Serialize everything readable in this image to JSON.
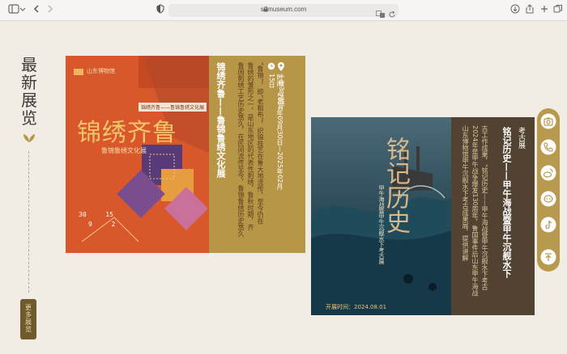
{
  "browser": {
    "url": "sdmuseum.com"
  },
  "section": {
    "title_chars": [
      "最",
      "新",
      "展",
      "览"
    ],
    "more_chars": [
      "更",
      "多",
      "展",
      "览"
    ]
  },
  "exhibitions": [
    {
      "poster": {
        "brand": "山东博物馆",
        "tag": "锦绣齐鲁——鲁锦鲁绣文化展",
        "title": "锦绣齐鲁",
        "subtitle": "鲁锦鲁绣文化展",
        "date_big": [
          "30",
          "9",
          "15",
          "2"
        ]
      },
      "panel": {
        "title": "锦绣齐鲁——鲁锦鲁绣文化展",
        "time": "时间：2024年09月30日—2025年02月15日",
        "place": "一楼3号展厅",
        "desc1": "“鲁锦”，即“老粗布”，织锦技艺在鲁大地流传，至今仍在",
        "desc2": "鲁绣的雏形之一，是山东地区的代表性刺绣，鲁秋时期，齐",
        "desc3": "鲁国刺绣工艺历史悠久，在民间流传至今，鲁锦鲁绣历史悠久"
      }
    },
    {
      "poster": {
        "title": "铭记历史",
        "subtitle": "甲午海战暨甲午沉舰水下考古展",
        "open": "开展时间：2024.08.01"
      },
      "panel": {
        "type": "考古展",
        "title": "铭记历史——甲午海战暨甲午沉舰水下",
        "desc1": "古工作成果，“铭记历史——甲午海战暨甲午沉舰水下考古",
        "desc2": "2024年是甲午战争爆发130周年，鲁国事件后山东甲午海战",
        "desc3": "山东博物馆甲午沉舰水下考古成果展，提供讲解"
      }
    }
  ],
  "colors": {
    "page_bg": "#f2ede4",
    "gold": "#b89648",
    "brown": "#514231",
    "poster_orange": "#d8582b"
  },
  "tools": [
    "camera-icon",
    "phone-icon",
    "weibo-icon",
    "wechat-icon",
    "tiktok-icon",
    "back-to-top-icon"
  ]
}
